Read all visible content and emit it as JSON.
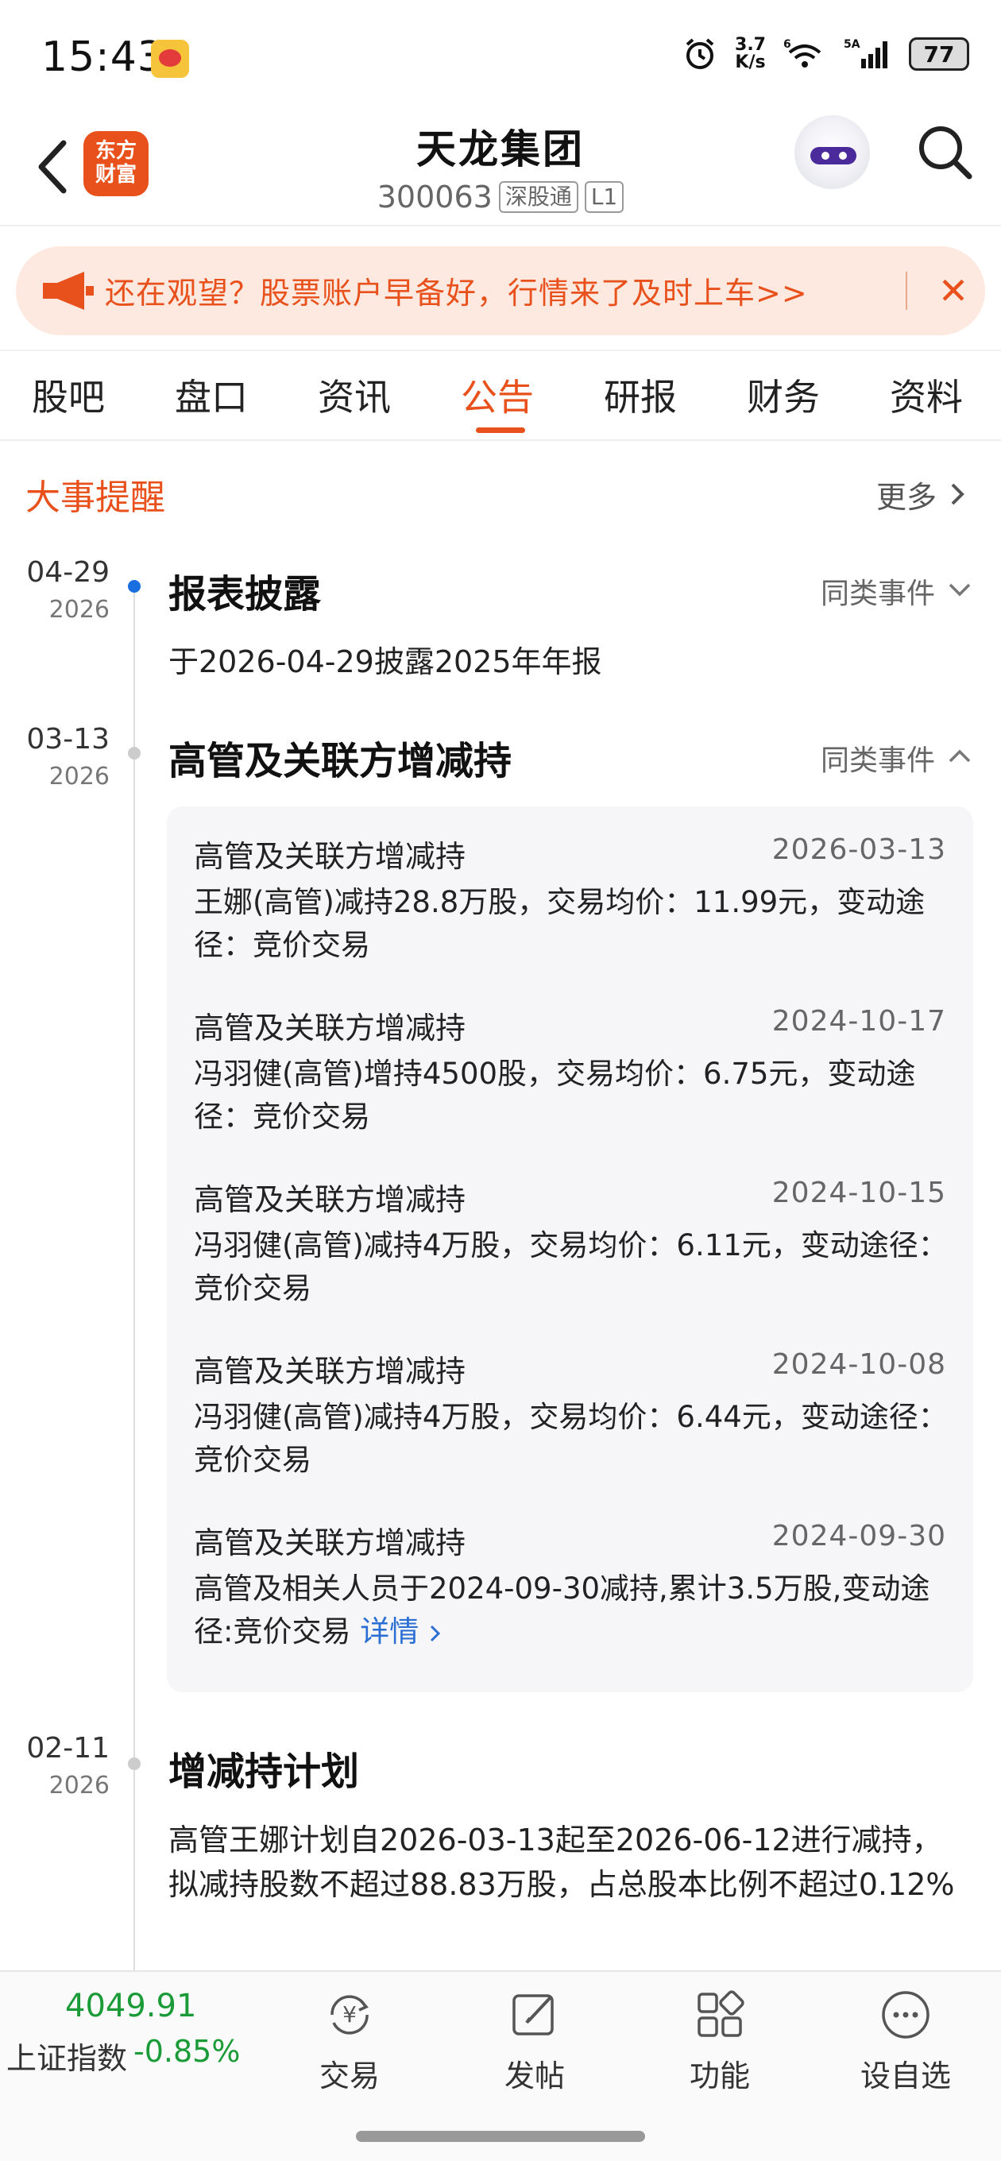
{
  "status_bar": {
    "time": "15:43",
    "net_speed_value": "3.7",
    "net_speed_unit": "K/s",
    "wifi_badge": "6",
    "signal_badge": "5A",
    "battery": "77"
  },
  "header": {
    "logo_text_line1": "东方",
    "logo_text_line2": "财富",
    "stock_name": "天龙集团",
    "stock_code": "300063",
    "tag_market": "深股通",
    "tag_level": "L1"
  },
  "banner": {
    "text": "还在观望？股票账户早备好，行情来了及时上车>>",
    "close": "✕"
  },
  "tabs": [
    {
      "label": "股吧"
    },
    {
      "label": "盘口"
    },
    {
      "label": "资讯"
    },
    {
      "label": "公告"
    },
    {
      "label": "研报"
    },
    {
      "label": "财务"
    },
    {
      "label": "资料"
    }
  ],
  "active_tab": "公告",
  "section": {
    "title": "大事提醒",
    "more": "更多"
  },
  "events": [
    {
      "date": "04-29",
      "year": "2026",
      "title": "报表披露",
      "same_label": "同类事件",
      "text": "于2026-04-29披露2025年年报"
    },
    {
      "date": "03-13",
      "year": "2026",
      "title": "高管及关联方增减持",
      "same_label": "同类事件",
      "items": [
        {
          "title": "高管及关联方增减持",
          "date": "2026-03-13",
          "text": "王娜(高管)减持28.8万股，交易均价：11.99元，变动途径：竞价交易"
        },
        {
          "title": "高管及关联方增减持",
          "date": "2024-10-17",
          "text": "冯羽健(高管)增持4500股，交易均价：6.75元，变动途径：竞价交易"
        },
        {
          "title": "高管及关联方增减持",
          "date": "2024-10-15",
          "text": "冯羽健(高管)减持4万股，交易均价：6.11元，变动途径：竞价交易"
        },
        {
          "title": "高管及关联方增减持",
          "date": "2024-10-08",
          "text": "冯羽健(高管)减持4万股，交易均价：6.44元，变动途径：竞价交易"
        },
        {
          "title": "高管及关联方增减持",
          "date": "2024-09-30",
          "text": "高管及相关人员于2024-09-30减持,累计3.5万股,变动途径:竞价交易",
          "link": "详情"
        }
      ]
    },
    {
      "date": "02-11",
      "year": "2026",
      "title": "增减持计划",
      "text": "高管王娜计划自2026-03-13起至2026-06-12进行减持，拟减持股数不超过88.83万股，占总股本比例不超过0.12%"
    }
  ],
  "bottom_bar": {
    "index_value": "4049.91",
    "index_name": "上证指数",
    "index_change": "-0.85%",
    "buttons": [
      {
        "label": "交易",
        "icon": "yen-refresh-icon"
      },
      {
        "label": "发帖",
        "icon": "edit-icon"
      },
      {
        "label": "功能",
        "icon": "grid-icon"
      },
      {
        "label": "设自选",
        "icon": "more-circle-icon"
      }
    ]
  },
  "colors": {
    "accent": "#e8511c",
    "banner_bg": "#fde9df",
    "down_green": "#1a9b37",
    "link_blue": "#2b6fd3",
    "timeline_active": "#1a6fe0"
  }
}
